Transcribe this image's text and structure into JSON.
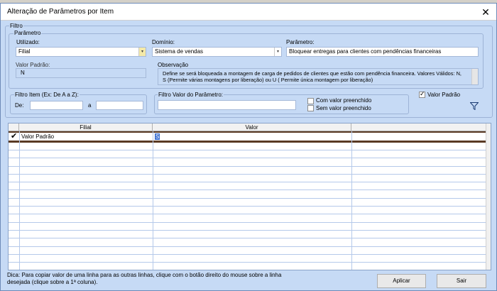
{
  "window": {
    "title": "Alteração de Parâmetros por Item",
    "close_symbol": "✕"
  },
  "filtro": {
    "group_label": "Filtro",
    "parametro_group": {
      "label": "Parâmetro",
      "utilizado": {
        "label": "Utilizado:",
        "value": "Filial"
      },
      "dominio": {
        "label": "Domínio:",
        "value": "Sistema de vendas"
      },
      "parametro": {
        "label": "Parâmetro:",
        "value": "Bloquear entregas para clientes com pendências financeiras"
      },
      "valor_padrao": {
        "label": "Valor Padrão:",
        "value": "N"
      },
      "observacao": {
        "label": "Observação",
        "line1": "Define se será bloqueada a montagem de carga de pedidos de clientes que estão com pendência financeira. Valores Válidos: N,",
        "line2": "S (Permite várias montagens por liberação)  ou U ( Permite única montagem por liberação)"
      }
    },
    "filtro_item": {
      "label": "Filtro Item (Ex: De A a Z):",
      "de_label": "De:",
      "a_label": "a",
      "de_value": "",
      "a_value": ""
    },
    "filtro_valor": {
      "label": "Filtro Valor do Parâmetro:",
      "value": "",
      "com_valor": "Com valor preenchido",
      "sem_valor": "Sem valor preenchido"
    },
    "valor_padrao_check": {
      "label": "Valor Padrão",
      "checked": true
    },
    "filter_icon": "funnel-icon"
  },
  "grid": {
    "columns": [
      "Filial",
      "Valor"
    ],
    "rows": [
      {
        "filial": "Valor Padrão",
        "valor": "S",
        "checked": true
      }
    ]
  },
  "footer": {
    "hint_line1": "Dica: Para copiar valor de uma linha para as outras linhas, clique com o botão direito do mouse sobre a linha",
    "hint_line2": "desejada (clique sobre a 1ª coluna).",
    "aplicar": "Aplicar",
    "sair": "Sair"
  }
}
